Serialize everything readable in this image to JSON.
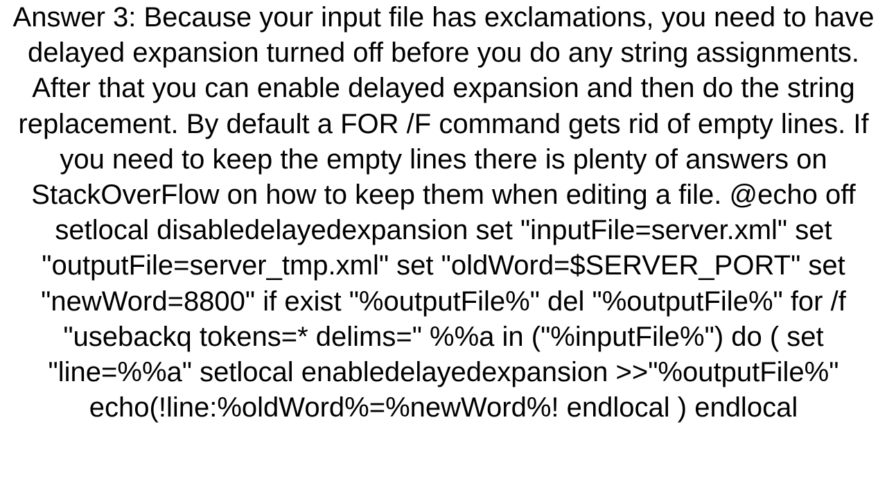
{
  "answer": {
    "text": "Answer 3: Because your input file has exclamations, you need to have delayed expansion turned off before you do any string assignments.  After that you can enable delayed expansion and then do the string replacement.  By default a FOR /F command gets rid of empty lines.  If you need to keep the empty lines there is plenty of answers on StackOverFlow on how to keep them when editing a file. @echo off setlocal disabledelayedexpansion  set \"inputFile=server.xml\" set \"outputFile=server_tmp.xml\" set \"oldWord=$SERVER_PORT\" set \"newWord=8800\"  if exist \"%outputFile%\" del \"%outputFile%\"  for /f \"usebackq tokens=* delims=\" %%a in (\"%inputFile%\") do (     set \"line=%%a\"     setlocal enabledelayedexpansion     >>\"%outputFile%\" echo(!line:%oldWord%=%newWord%!     endlocal ) endlocal"
  }
}
